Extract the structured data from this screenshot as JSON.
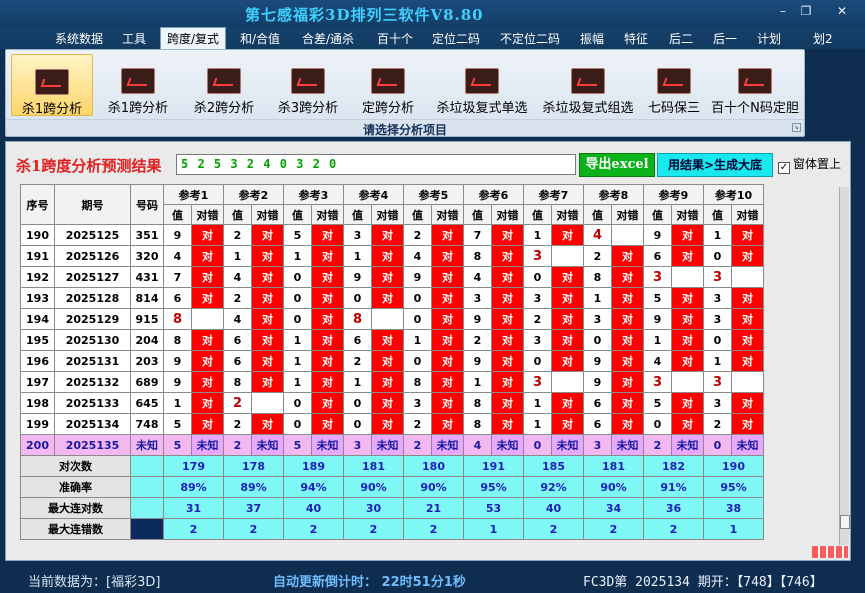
{
  "window": {
    "title": "第七感福彩3D排列三软件V8.80",
    "minimize": "–",
    "maximize": "❐",
    "close": "✕"
  },
  "menu": [
    "系统数据",
    "工具",
    "跨度/复式",
    "和/合值",
    "合差/通杀",
    "百十个",
    "定位二码",
    "不定位二码",
    "振幅",
    "特征",
    "后二",
    "后一",
    "计划",
    "划2"
  ],
  "menu_active": "跨度/复式",
  "ribbon": {
    "buttons": [
      "杀1跨分析",
      "杀1跨分析",
      "杀2跨分析",
      "杀3跨分析",
      "定跨分析",
      "杀垃圾复式单选",
      "杀垃圾复式组选",
      "七码保三",
      "百十个N码定胆"
    ],
    "selected": 0,
    "group_label": "请选择分析项目"
  },
  "panel": {
    "title": "杀1跨度分析预测结果",
    "result": "5 2 5 3 2 4 0 3 2 0",
    "export_button": "导出excel",
    "generate_button": "用结果>生成大底",
    "pin_label": "窗体置上",
    "pin_checked": "✓"
  },
  "table": {
    "headers": {
      "seq": "序号",
      "period": "期号",
      "number": "号码",
      "val": "值",
      "ok": "对错"
    },
    "refs": [
      "参考1",
      "参考2",
      "参考3",
      "参考4",
      "参考5",
      "参考6",
      "参考7",
      "参考8",
      "参考9",
      "参考10"
    ],
    "ok_text": "对",
    "rows": [
      {
        "seq": "190",
        "period": "2025125",
        "num": "351",
        "vals": [
          "9",
          "2",
          "5",
          "3",
          "2",
          "7",
          "1",
          "4",
          "9",
          "1"
        ],
        "ok": [
          1,
          1,
          1,
          1,
          1,
          1,
          1,
          0,
          1,
          1
        ]
      },
      {
        "seq": "191",
        "period": "2025126",
        "num": "320",
        "vals": [
          "4",
          "1",
          "1",
          "1",
          "4",
          "8",
          "3",
          "2",
          "6",
          "0"
        ],
        "ok": [
          1,
          1,
          1,
          1,
          1,
          1,
          0,
          1,
          1,
          1
        ]
      },
      {
        "seq": "192",
        "period": "2025127",
        "num": "431",
        "vals": [
          "7",
          "4",
          "0",
          "9",
          "9",
          "4",
          "0",
          "8",
          "3",
          "3"
        ],
        "ok": [
          1,
          1,
          1,
          1,
          1,
          1,
          1,
          1,
          0,
          0
        ]
      },
      {
        "seq": "193",
        "period": "2025128",
        "num": "814",
        "vals": [
          "6",
          "2",
          "0",
          "0",
          "0",
          "3",
          "3",
          "1",
          "5",
          "3"
        ],
        "ok": [
          1,
          1,
          1,
          1,
          1,
          1,
          1,
          1,
          1,
          1
        ]
      },
      {
        "seq": "194",
        "period": "2025129",
        "num": "915",
        "vals": [
          "8",
          "4",
          "0",
          "8",
          "0",
          "9",
          "2",
          "3",
          "9",
          "3"
        ],
        "ok": [
          0,
          1,
          1,
          0,
          1,
          1,
          1,
          1,
          1,
          1
        ]
      },
      {
        "seq": "195",
        "period": "2025130",
        "num": "204",
        "vals": [
          "8",
          "6",
          "1",
          "6",
          "1",
          "2",
          "3",
          "0",
          "1",
          "0"
        ],
        "ok": [
          1,
          1,
          1,
          1,
          1,
          1,
          1,
          1,
          1,
          1
        ]
      },
      {
        "seq": "196",
        "period": "2025131",
        "num": "203",
        "vals": [
          "9",
          "6",
          "1",
          "2",
          "0",
          "9",
          "0",
          "9",
          "4",
          "1"
        ],
        "ok": [
          1,
          1,
          1,
          1,
          1,
          1,
          1,
          1,
          1,
          1
        ]
      },
      {
        "seq": "197",
        "period": "2025132",
        "num": "689",
        "vals": [
          "9",
          "8",
          "1",
          "1",
          "8",
          "1",
          "3",
          "9",
          "3",
          "3"
        ],
        "ok": [
          1,
          1,
          1,
          1,
          1,
          1,
          0,
          1,
          0,
          0
        ]
      },
      {
        "seq": "198",
        "period": "2025133",
        "num": "645",
        "vals": [
          "1",
          "2",
          "0",
          "0",
          "3",
          "8",
          "1",
          "6",
          "5",
          "3"
        ],
        "ok": [
          1,
          0,
          1,
          1,
          1,
          1,
          1,
          1,
          1,
          1
        ]
      },
      {
        "seq": "199",
        "period": "2025134",
        "num": "748",
        "vals": [
          "5",
          "2",
          "0",
          "0",
          "2",
          "8",
          "1",
          "6",
          "0",
          "2"
        ],
        "ok": [
          1,
          1,
          1,
          1,
          1,
          1,
          1,
          1,
          1,
          1
        ]
      }
    ],
    "current": {
      "seq": "200",
      "period": "2025135",
      "num": "未知",
      "vals": [
        "5",
        "2",
        "5",
        "3",
        "2",
        "4",
        "0",
        "3",
        "2",
        "0"
      ],
      "status": "未知"
    },
    "stats": [
      {
        "label": "对次数",
        "values": [
          "179",
          "178",
          "189",
          "181",
          "180",
          "191",
          "185",
          "181",
          "182",
          "190"
        ]
      },
      {
        "label": "准确率",
        "values": [
          "89%",
          "89%",
          "94%",
          "90%",
          "90%",
          "95%",
          "92%",
          "90%",
          "91%",
          "95%"
        ]
      },
      {
        "label": "最大连对数",
        "values": [
          "31",
          "37",
          "40",
          "30",
          "21",
          "53",
          "40",
          "34",
          "36",
          "38"
        ]
      },
      {
        "label": "最大连错数",
        "values": [
          "2",
          "2",
          "2",
          "2",
          "2",
          "1",
          "2",
          "2",
          "2",
          "1"
        ]
      }
    ]
  },
  "status_bar": {
    "current_data": "当前数据为：[福彩3D]",
    "countdown": "自动更新倒计时：  22时51分1秒",
    "draw_info": "FC3D第 2025134 期开：【748】【746】"
  },
  "colors": {
    "hit": "#ff0000",
    "miss_value": "#c00000",
    "current_row": "#f3b7f2",
    "stats": "#7ff7f5"
  }
}
